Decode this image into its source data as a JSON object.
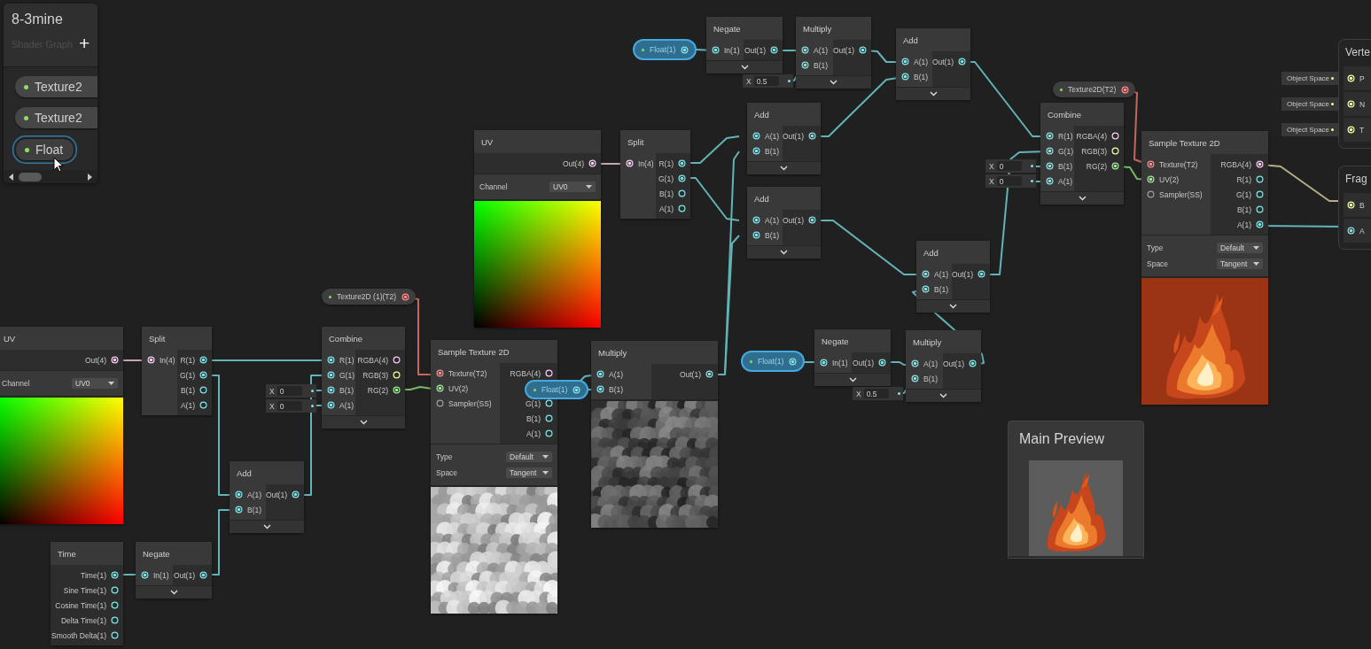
{
  "blackboard": {
    "title": "8-3mine",
    "subtitle": "Shader Graph",
    "add_button": "+",
    "properties": [
      {
        "label": "Texture2",
        "selected": false
      },
      {
        "label": "Texture2",
        "selected": false
      },
      {
        "label": "Float",
        "selected": true
      }
    ]
  },
  "nodes": [
    {
      "title": "Negate",
      "inputs": [
        {
          "label": "In(1)",
          "color": "#84e4e7",
          "connected": true
        }
      ],
      "outputs": [
        {
          "label": "Out(1)",
          "color": "#84e4e7",
          "connected": true
        }
      ],
      "collapsible": true
    },
    {
      "title": "Multiply",
      "inputs": [
        {
          "label": "A(1)",
          "color": "#84e4e7",
          "connected": true
        },
        {
          "label": "B(1)",
          "color": "#84e4e7",
          "connected": true
        }
      ],
      "outputs": [
        {
          "label": "Out(1)",
          "color": "#84e4e7",
          "connected": true
        }
      ],
      "collapsible": true
    },
    {
      "title": "Add",
      "inputs": [
        {
          "label": "A(1)",
          "color": "#84e4e7",
          "connected": true
        },
        {
          "label": "B(1)",
          "color": "#84e4e7",
          "connected": true
        }
      ],
      "outputs": [
        {
          "label": "Out(1)",
          "color": "#84e4e7",
          "connected": true
        }
      ],
      "collapsible": true
    },
    {
      "title": "Add",
      "inputs": [
        {
          "label": "A(1)",
          "color": "#84e4e7",
          "connected": true
        },
        {
          "label": "B(1)",
          "color": "#84e4e7",
          "connected": true
        }
      ],
      "outputs": [
        {
          "label": "Out(1)",
          "color": "#84e4e7",
          "connected": true
        }
      ],
      "collapsible": true
    },
    {
      "title": "UV",
      "outputs": [
        {
          "label": "Out(4)",
          "color": "#fbcbf4",
          "connected": true
        }
      ],
      "controls": [
        {
          "label": "Channel",
          "value": "UV0"
        }
      ],
      "preview": {
        "kind": "uv"
      }
    },
    {
      "title": "Split",
      "inputs": [
        {
          "label": "In(4)",
          "color": "#fbcbf4",
          "connected": true
        }
      ],
      "outputs": [
        {
          "label": "R(1)",
          "color": "#84e4e7",
          "connected": true
        },
        {
          "label": "G(1)",
          "color": "#84e4e7",
          "connected": true
        },
        {
          "label": "B(1)",
          "color": "#84e4e7",
          "connected": false
        },
        {
          "label": "A(1)",
          "color": "#84e4e7",
          "connected": false
        }
      ]
    },
    {
      "title": "Combine",
      "inputs": [
        {
          "label": "R(1)",
          "color": "#84e4e7",
          "connected": true
        },
        {
          "label": "G(1)",
          "color": "#84e4e7",
          "connected": true
        },
        {
          "label": "B(1)",
          "color": "#84e4e7",
          "connected": true
        },
        {
          "label": "A(1)",
          "color": "#84e4e7",
          "connected": true
        }
      ],
      "outputs": [
        {
          "label": "RGBA(4)",
          "color": "#fbcbf4",
          "connected": false
        },
        {
          "label": "RGB(3)",
          "color": "#f6ff9a",
          "connected": false
        },
        {
          "label": "RG(2)",
          "color": "#9aef92",
          "connected": true
        }
      ],
      "collapsible": true
    },
    {
      "title": "Sample Texture 2D",
      "inputs": [
        {
          "label": "Texture(T2)",
          "color": "#ff8b8b",
          "connected": true
        },
        {
          "label": "UV(2)",
          "color": "#9aef92",
          "connected": true
        },
        {
          "label": "Sampler(SS)",
          "color": "#9c9c9c",
          "connected": false
        }
      ],
      "outputs": [
        {
          "label": "RGBA(4)",
          "color": "#fbcbf4",
          "connected": true
        },
        {
          "label": "R(1)",
          "color": "#84e4e7",
          "connected": false
        },
        {
          "label": "G(1)",
          "color": "#84e4e7",
          "connected": false
        },
        {
          "label": "B(1)",
          "color": "#84e4e7",
          "connected": false
        },
        {
          "label": "A(1)",
          "color": "#84e4e7",
          "connected": true
        }
      ],
      "controls": [
        {
          "label": "Type",
          "value": "Default"
        },
        {
          "label": "Space",
          "value": "Tangent"
        }
      ],
      "preview": {
        "kind": "fire"
      }
    },
    {
      "title": "Add",
      "inputs": [
        {
          "label": "A(1)",
          "color": "#84e4e7",
          "connected": true
        },
        {
          "label": "B(1)",
          "color": "#84e4e7",
          "connected": true
        }
      ],
      "outputs": [
        {
          "label": "Out(1)",
          "color": "#84e4e7",
          "connected": true
        }
      ],
      "collapsible": true
    },
    {
      "title": "Add",
      "inputs": [
        {
          "label": "A(1)",
          "color": "#84e4e7",
          "connected": true
        },
        {
          "label": "B(1)",
          "color": "#84e4e7",
          "connected": true
        }
      ],
      "outputs": [
        {
          "label": "Out(1)",
          "color": "#84e4e7",
          "connected": true
        }
      ],
      "collapsible": true
    },
    {
      "title": "UV",
      "outputs": [
        {
          "label": "Out(4)",
          "color": "#fbcbf4",
          "connected": true
        }
      ],
      "controls": [
        {
          "label": "Channel",
          "value": "UV0"
        }
      ],
      "preview": {
        "kind": "uv"
      }
    },
    {
      "title": "Split",
      "inputs": [
        {
          "label": "In(4)",
          "color": "#fbcbf4",
          "connected": true
        }
      ],
      "outputs": [
        {
          "label": "R(1)",
          "color": "#84e4e7",
          "connected": true
        },
        {
          "label": "G(1)",
          "color": "#84e4e7",
          "connected": true
        },
        {
          "label": "B(1)",
          "color": "#84e4e7",
          "connected": false
        },
        {
          "label": "A(1)",
          "color": "#84e4e7",
          "connected": false
        }
      ]
    },
    {
      "title": "Combine",
      "inputs": [
        {
          "label": "R(1)",
          "color": "#84e4e7",
          "connected": true
        },
        {
          "label": "G(1)",
          "color": "#84e4e7",
          "connected": true
        },
        {
          "label": "B(1)",
          "color": "#84e4e7",
          "connected": true
        },
        {
          "label": "A(1)",
          "color": "#84e4e7",
          "connected": true
        }
      ],
      "outputs": [
        {
          "label": "RGBA(4)",
          "color": "#fbcbf4",
          "connected": false
        },
        {
          "label": "RGB(3)",
          "color": "#f6ff9a",
          "connected": false
        },
        {
          "label": "RG(2)",
          "color": "#9aef92",
          "connected": true
        }
      ],
      "collapsible": true
    },
    {
      "title": "Sample Texture 2D",
      "inputs": [
        {
          "label": "Texture(T2)",
          "color": "#ff8b8b",
          "connected": true
        },
        {
          "label": "UV(2)",
          "color": "#9aef92",
          "connected": true
        },
        {
          "label": "Sampler(SS)",
          "color": "#9c9c9c",
          "connected": false
        }
      ],
      "outputs": [
        {
          "label": "RGBA(4)",
          "color": "#fbcbf4",
          "connected": false
        },
        {
          "label": "G(1)",
          "color": "#84e4e7",
          "connected": false
        },
        {
          "label": "B(1)",
          "color": "#84e4e7",
          "connected": false
        },
        {
          "label": "A(1)",
          "color": "#84e4e7",
          "connected": false
        }
      ],
      "controls": [
        {
          "label": "Type",
          "value": "Default"
        },
        {
          "label": "Space",
          "value": "Tangent"
        }
      ],
      "preview": {
        "kind": "noise_light"
      }
    },
    {
      "title": "Multiply",
      "inputs": [
        {
          "label": "A(1)",
          "color": "#84e4e7",
          "connected": true
        },
        {
          "label": "B(1)",
          "color": "#84e4e7",
          "connected": true
        }
      ],
      "outputs": [
        {
          "label": "Out(1)",
          "color": "#84e4e7",
          "connected": true
        }
      ],
      "preview": {
        "kind": "noise_dark"
      }
    },
    {
      "title": "Negate",
      "inputs": [
        {
          "label": "In(1)",
          "color": "#84e4e7",
          "connected": true
        }
      ],
      "outputs": [
        {
          "label": "Out(1)",
          "color": "#84e4e7",
          "connected": true
        }
      ],
      "collapsible": true
    },
    {
      "title": "Multiply",
      "inputs": [
        {
          "label": "A(1)",
          "color": "#84e4e7",
          "connected": true
        },
        {
          "label": "B(1)",
          "color": "#84e4e7",
          "connected": true
        }
      ],
      "outputs": [
        {
          "label": "Out(1)",
          "color": "#84e4e7",
          "connected": true
        }
      ],
      "collapsible": true
    },
    {
      "title": "Add",
      "inputs": [
        {
          "label": "A(1)",
          "color": "#84e4e7",
          "connected": true
        },
        {
          "label": "B(1)",
          "color": "#84e4e7",
          "connected": true
        }
      ],
      "outputs": [
        {
          "label": "Out(1)",
          "color": "#84e4e7",
          "connected": true
        }
      ],
      "collapsible": true
    },
    {
      "title": "Time",
      "outputs": [
        {
          "label": "Time(1)",
          "color": "#84e4e7",
          "connected": true
        },
        {
          "label": "Sine Time(1)",
          "color": "#84e4e7",
          "connected": false
        },
        {
          "label": "Cosine Time(1)",
          "color": "#84e4e7",
          "connected": false
        },
        {
          "label": "Delta Time(1)",
          "color": "#84e4e7",
          "connected": false
        },
        {
          "label": "Smooth Delta(1)",
          "color": "#84e4e7",
          "connected": false
        }
      ]
    },
    {
      "title": "Negate",
      "inputs": [
        {
          "label": "In(1)",
          "color": "#84e4e7",
          "connected": true
        }
      ],
      "outputs": [
        {
          "label": "Out(1)",
          "color": "#84e4e7",
          "connected": true
        }
      ],
      "collapsible": true
    }
  ],
  "property_nodes": [
    {
      "label": "Float(1)",
      "color": "#84e4e7",
      "selected": true
    },
    {
      "label": "Texture2D(T2)",
      "color": "#ff8b8b",
      "selected": false
    },
    {
      "label": "Texture2D (1)(T2)",
      "color": "#ff8b8b",
      "selected": false
    },
    {
      "label": "Float(1)",
      "color": "#84e4e7",
      "selected": true
    },
    {
      "label": "Float(1)",
      "color": "#84e4e7",
      "selected": true
    }
  ],
  "inline_fields": [
    {
      "axis": "X",
      "value": "0.5"
    },
    {
      "axis": "X",
      "value": "0"
    },
    {
      "axis": "X",
      "value": "0"
    },
    {
      "axis": "X",
      "value": "0"
    },
    {
      "axis": "X",
      "value": "0"
    },
    {
      "axis": "X",
      "value": "0.5"
    }
  ],
  "master_stacks": [
    {
      "title": "Verte",
      "ports": [
        {
          "label": "P",
          "color": "#f6ff9a",
          "default": "Object Space"
        },
        {
          "label": "N",
          "color": "#f6ff9a",
          "default": "Object Space"
        },
        {
          "label": "T",
          "color": "#f6ff9a",
          "default": "Object Space"
        }
      ]
    },
    {
      "title": "Frag",
      "ports": [
        {
          "label": "B",
          "color": "#f6ff9a"
        },
        {
          "label": "A",
          "color": "#84e4e7"
        }
      ]
    }
  ],
  "main_preview": {
    "title": "Main Preview",
    "preview": {
      "kind": "fire"
    }
  }
}
